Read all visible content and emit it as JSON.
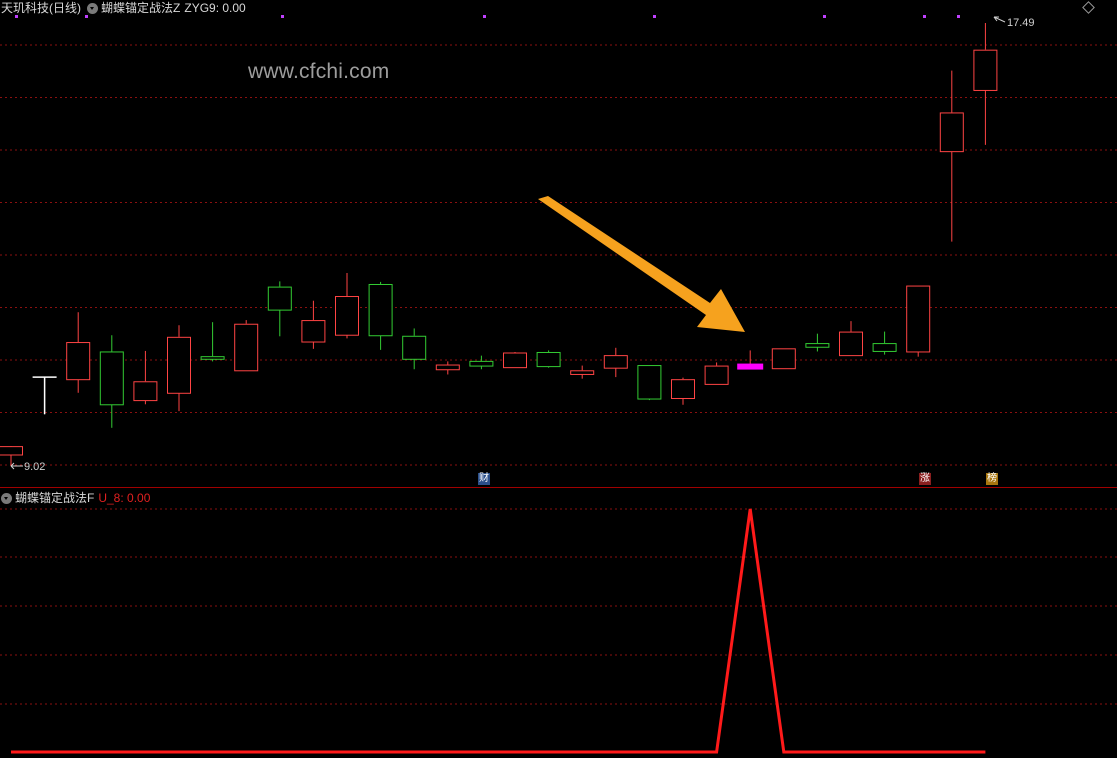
{
  "main_pane": {
    "stock_name": "天玑科技",
    "period": "(日线)",
    "indicator_name": "蝴蝶锚定战法Z",
    "indicator_value": "ZYG9: 0.00",
    "watermark": "www.cfchi.com",
    "high_label": "17.49",
    "low_label": "9.02",
    "badges": {
      "cai": "财",
      "zhang": "涨",
      "bang": "榜"
    },
    "colors": {
      "up": "#ff4444",
      "down": "#33cc33",
      "doji": "#ffffff",
      "signal": "#ff00ff",
      "arrow": "#f6a21e",
      "grid": "#8a1010"
    }
  },
  "sub_pane": {
    "indicator_name": "蝴蝶锚定战法F",
    "indicator_value": "U_8: 0.00",
    "line_color": "#ff1a1a"
  },
  "chart_data": {
    "type": "candlestick",
    "price_range": [
      9.02,
      17.49
    ],
    "candles": [
      {
        "open": 9.4,
        "close": 9.24,
        "high": 9.24,
        "low": 9.02,
        "dir": "up"
      },
      {
        "open": 10.72,
        "close": 10.72,
        "high": 10.72,
        "low": 10.01,
        "dir": "doji"
      },
      {
        "open": 10.68,
        "close": 11.39,
        "high": 11.96,
        "low": 10.42,
        "dir": "up"
      },
      {
        "open": 11.21,
        "close": 10.2,
        "high": 11.52,
        "low": 9.75,
        "dir": "down"
      },
      {
        "open": 10.28,
        "close": 10.64,
        "high": 11.22,
        "low": 10.2,
        "dir": "up"
      },
      {
        "open": 10.42,
        "close": 11.49,
        "high": 11.71,
        "low": 10.07,
        "dir": "up"
      },
      {
        "open": 11.12,
        "close": 11.07,
        "high": 11.77,
        "low": 11.02,
        "dir": "down"
      },
      {
        "open": 10.85,
        "close": 11.74,
        "high": 11.81,
        "low": 10.85,
        "dir": "up"
      },
      {
        "open": 12.01,
        "close": 12.45,
        "high": 12.55,
        "low": 11.5,
        "dir": "down"
      },
      {
        "open": 11.4,
        "close": 11.81,
        "high": 12.18,
        "low": 11.26,
        "dir": "up"
      },
      {
        "open": 12.27,
        "close": 11.53,
        "high": 12.71,
        "low": 11.46,
        "dir": "up"
      },
      {
        "open": 12.5,
        "close": 11.52,
        "high": 12.54,
        "low": 11.24,
        "dir": "down"
      },
      {
        "open": 11.07,
        "close": 11.51,
        "high": 11.65,
        "low": 10.87,
        "dir": "down"
      },
      {
        "open": 10.87,
        "close": 10.96,
        "high": 11.02,
        "low": 10.77,
        "dir": "up"
      },
      {
        "open": 10.94,
        "close": 11.03,
        "high": 11.13,
        "low": 10.87,
        "dir": "down"
      },
      {
        "open": 10.91,
        "close": 11.19,
        "high": 11.2,
        "low": 10.91,
        "dir": "up"
      },
      {
        "open": 11.2,
        "close": 10.93,
        "high": 11.23,
        "low": 10.9,
        "dir": "down"
      },
      {
        "open": 10.78,
        "close": 10.85,
        "high": 10.94,
        "low": 10.69,
        "dir": "up"
      },
      {
        "open": 10.9,
        "close": 11.14,
        "high": 11.28,
        "low": 10.72,
        "dir": "up"
      },
      {
        "open": 10.95,
        "close": 10.31,
        "high": 10.95,
        "low": 10.28,
        "dir": "down"
      },
      {
        "open": 10.32,
        "close": 10.68,
        "high": 10.71,
        "low": 10.19,
        "dir": "up"
      },
      {
        "open": 10.59,
        "close": 10.94,
        "high": 11.0,
        "low": 10.59,
        "dir": "up"
      },
      {
        "open": 10.91,
        "close": 10.94,
        "high": 11.23,
        "low": 10.91,
        "dir": "up",
        "signal": true
      },
      {
        "open": 10.89,
        "close": 11.27,
        "high": 11.27,
        "low": 10.89,
        "dir": "up"
      },
      {
        "open": 11.3,
        "close": 11.37,
        "high": 11.55,
        "low": 11.21,
        "dir": "down"
      },
      {
        "open": 11.14,
        "close": 11.59,
        "high": 11.79,
        "low": 11.14,
        "dir": "up"
      },
      {
        "open": 11.37,
        "close": 11.22,
        "high": 11.59,
        "low": 11.15,
        "dir": "down"
      },
      {
        "open": 11.21,
        "close": 12.47,
        "high": 12.47,
        "low": 11.11,
        "dir": "up"
      },
      {
        "open": 15.04,
        "close": 15.78,
        "high": 16.58,
        "low": 13.31,
        "dir": "up"
      },
      {
        "open": 16.21,
        "close": 16.98,
        "high": 17.49,
        "low": 15.16,
        "dir": "up"
      }
    ],
    "indicator": {
      "name": "U_8",
      "values": [
        0,
        0,
        0,
        0,
        0,
        0,
        0,
        0,
        0,
        0,
        0,
        0,
        0,
        0,
        0,
        0,
        0,
        0,
        0,
        0,
        0,
        0,
        1,
        0,
        0,
        0,
        0,
        0,
        0,
        0
      ]
    }
  }
}
